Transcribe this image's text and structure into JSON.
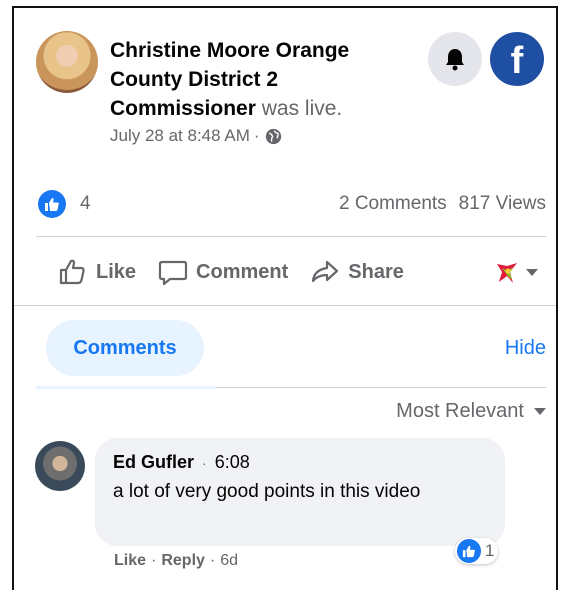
{
  "post": {
    "author": "Christine Moore Orange County District 2 Commissioner",
    "status": "was live.",
    "date": "July 28 at 8:48 AM",
    "date_sep": "·"
  },
  "stats": {
    "likes": "4",
    "comments": "2 Comments",
    "views": "817 Views"
  },
  "actions": {
    "like": "Like",
    "comment": "Comment",
    "share": "Share"
  },
  "comments_section": {
    "tab": "Comments",
    "hide": "Hide",
    "sort": "Most Relevant"
  },
  "comment": {
    "name": "Ed Gufler",
    "dot": "·",
    "time": "6:08",
    "text": "a lot of very good points in this video",
    "reaction_count": "1",
    "like": "Like",
    "reply": "Reply",
    "age": "6d",
    "sep": "·"
  },
  "colors": {
    "accent": "#1877f2",
    "muted": "#65676b",
    "pill_bg": "#e7f3ff",
    "bubble_bg": "#f0f2f5",
    "fb_brand": "#1f4fa3"
  },
  "icons": {
    "bell": "bell-icon",
    "facebook": "facebook-logo-icon",
    "globe": "globe-icon",
    "thumb": "thumbs-up-icon",
    "comment": "comment-icon",
    "share": "share-icon",
    "reaction": "reaction-picker-icon"
  }
}
